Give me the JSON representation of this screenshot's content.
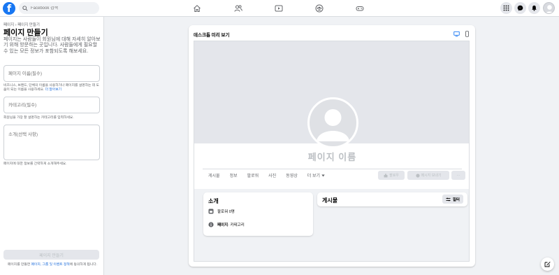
{
  "topbar": {
    "logo": "f",
    "search_placeholder": "Facebook 검색",
    "nav_icons": [
      "home-icon",
      "friends-icon",
      "watch-icon",
      "groups-icon",
      "gaming-icon"
    ],
    "right_icons": [
      "menu-grid-icon",
      "messenger-icon",
      "bell-icon",
      "account-avatar"
    ]
  },
  "left": {
    "breadcrumb": "페이지 › 페이지 만들기",
    "title": "페이지 만들기",
    "description": "페이지는 사람들이 회원님에 대해 자세히 알아보기 위해 방문하는 곳입니다. 사람들에게 필요할 수 있는 모든 정보가 포함되도록 해보세요.",
    "name_placeholder": "페이지 이름(필수)",
    "name_hint": "비즈니스, 브랜드, 단체의 이름을 사용하거나 페이지를 설명하는 데 도움이 되는 이름을 사용하세요.",
    "name_hint_link": "더 알아보기",
    "category_placeholder": "카테고리(필수)",
    "category_hint": "회원님을 가장 잘 설명하는 카테고리를 입력하세요.",
    "intro_placeholder": "소개(선택 사항)",
    "intro_hint": "페이지에 대한 정보를 간략하게 소개해주세요.",
    "create_button": "페이지 만들기",
    "terms_prefix": "페이지를 만들면 ",
    "terms_link": "페이지, 그룹 및 이벤트 정책",
    "terms_suffix": "에 동의하게 됩니다."
  },
  "preview": {
    "title": "데스크톱 미리 보기",
    "page_name": "페이지 이름",
    "tabs": [
      "게시물",
      "정보",
      "팔로워",
      "사진",
      "동영상"
    ],
    "tab_more": "더 보기",
    "like_button": "팔로우",
    "message_button": "메시지 보내기",
    "more_button": "···",
    "intro_title": "소개",
    "followers_text": "팔로워 0명",
    "page_label": "페이지",
    "page_category": " · 카테고리",
    "posts_title": "게시물",
    "filter_button": "필터"
  },
  "colors": {
    "brand": "#1877f2",
    "link": "#216fdb",
    "disabled_text": "#bcc0c4"
  }
}
